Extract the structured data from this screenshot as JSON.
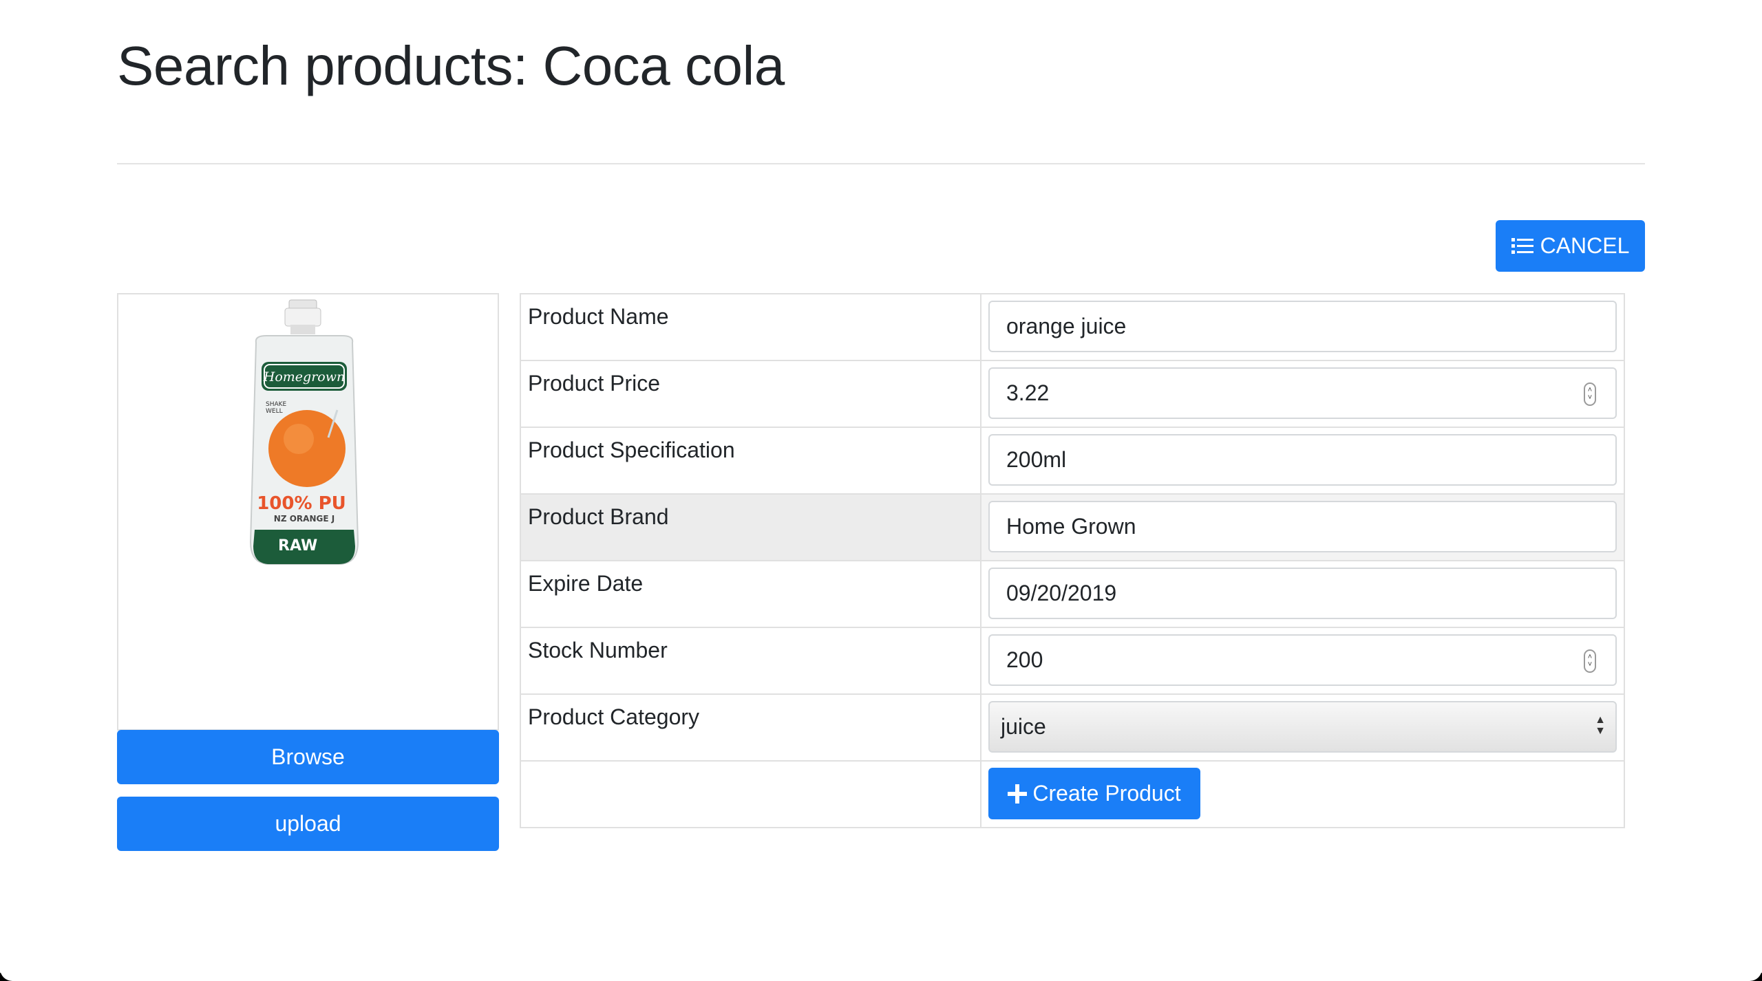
{
  "page": {
    "title": "Search products: Coca cola"
  },
  "toolbar": {
    "cancel_label": "CANCEL",
    "cancel_icon": "list-icon"
  },
  "image_panel": {
    "image_alt": "Homegrown 100% pure NZ orange juice pouch",
    "browse_label": "Browse",
    "upload_label": "upload"
  },
  "form": {
    "rows": [
      {
        "label": "Product Name",
        "value": "orange juice",
        "type": "text"
      },
      {
        "label": "Product Price",
        "value": "3.22",
        "type": "number"
      },
      {
        "label": "Product Specification",
        "value": "200ml",
        "type": "text"
      },
      {
        "label": "Product Brand",
        "value": "Home Grown",
        "type": "text"
      },
      {
        "label": "Expire Date",
        "value": "09/20/2019",
        "type": "date"
      },
      {
        "label": "Stock Number",
        "value": "200",
        "type": "number"
      },
      {
        "label": "Product Category",
        "value": "juice",
        "type": "select"
      }
    ],
    "submit_label": "Create Product",
    "submit_icon": "plus-icon"
  },
  "colors": {
    "primary": "#1a7ef7",
    "border": "#e0e0e0",
    "highlight_row": "#ececec"
  }
}
